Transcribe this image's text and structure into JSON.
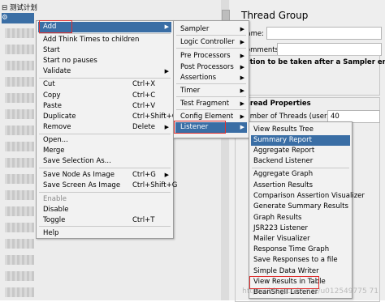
{
  "tree": {
    "root_label": "测试计划",
    "selected_label": "Thread Group"
  },
  "panel": {
    "title": "Thread Group",
    "name_label": "Name:",
    "comments_label": "Comments:",
    "error_action_label": "Action to be taken after a Sampler error",
    "thread_props_label": "Thread Properties",
    "threads_label": "Number of Threads (users):",
    "threads_value": "40"
  },
  "context_menu": {
    "items": [
      {
        "label": "Add",
        "shortcut": "",
        "submenu": true,
        "highlighted": true
      },
      {
        "label": "Add Think Times to children",
        "shortcut": ""
      },
      {
        "label": "Start",
        "shortcut": ""
      },
      {
        "label": "Start no pauses",
        "shortcut": ""
      },
      {
        "label": "Validate",
        "shortcut": ""
      },
      {
        "label": "Cut",
        "shortcut": "Ctrl+X"
      },
      {
        "label": "Copy",
        "shortcut": "Ctrl+C"
      },
      {
        "label": "Paste",
        "shortcut": "Ctrl+V"
      },
      {
        "label": "Duplicate",
        "shortcut": "Ctrl+Shift+C"
      },
      {
        "label": "Remove",
        "shortcut": "Delete"
      },
      {
        "label": "Open...",
        "shortcut": ""
      },
      {
        "label": "Merge",
        "shortcut": ""
      },
      {
        "label": "Save Selection As...",
        "shortcut": ""
      },
      {
        "label": "Save Node As Image",
        "shortcut": "Ctrl+G"
      },
      {
        "label": "Save Screen As Image",
        "shortcut": "Ctrl+Shift+G"
      },
      {
        "label": "Enable",
        "shortcut": "",
        "disabled": true
      },
      {
        "label": "Disable",
        "shortcut": ""
      },
      {
        "label": "Toggle",
        "shortcut": "Ctrl+T"
      },
      {
        "label": "Help",
        "shortcut": ""
      }
    ]
  },
  "add_menu": {
    "items": [
      {
        "label": "Sampler"
      },
      {
        "label": "Logic Controller"
      },
      {
        "label": "Pre Processors"
      },
      {
        "label": "Post Processors"
      },
      {
        "label": "Assertions"
      },
      {
        "label": "Timer"
      },
      {
        "label": "Test Fragment"
      },
      {
        "label": "Config Element"
      },
      {
        "label": "Listener",
        "highlighted": true
      }
    ]
  },
  "listener_menu": {
    "items": [
      {
        "label": "View Results Tree"
      },
      {
        "label": "Summary Report",
        "highlighted": true
      },
      {
        "label": "Aggregate Report"
      },
      {
        "label": "Backend Listener"
      },
      {
        "label": "Aggregate Graph"
      },
      {
        "label": "Assertion Results"
      },
      {
        "label": "Comparison Assertion Visualizer"
      },
      {
        "label": "Generate Summary Results"
      },
      {
        "label": "Graph Results"
      },
      {
        "label": "JSR223 Listener"
      },
      {
        "label": "Mailer Visualizer"
      },
      {
        "label": "Response Time Graph"
      },
      {
        "label": "Save Responses to a file"
      },
      {
        "label": "Simple Data Writer"
      },
      {
        "label": "View Results in Table",
        "boxed": true
      },
      {
        "label": "BeanShell Listener"
      }
    ]
  },
  "watermark": "https://blog.csdn.net/u012549775 71",
  "colors": {
    "highlight": "#3a6ea5",
    "annotation": "#e03030"
  }
}
